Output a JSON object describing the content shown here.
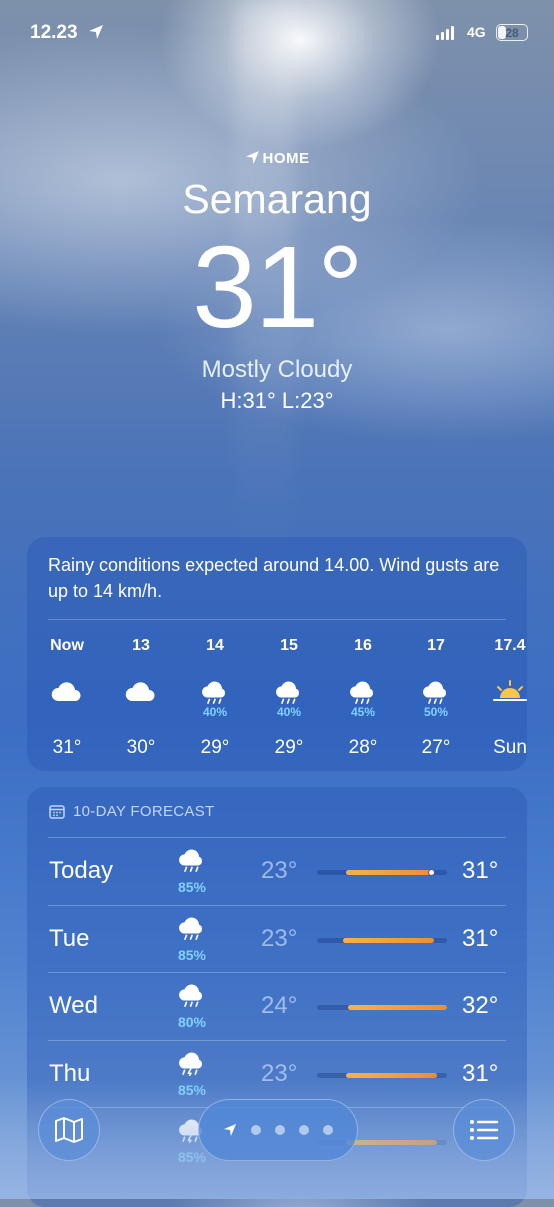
{
  "status_bar": {
    "time": "12.23",
    "network": "4G",
    "battery": "28",
    "battery_level": 0.28
  },
  "header": {
    "home_label": "HOME",
    "city": "Semarang",
    "temperature": "31°",
    "condition": "Mostly Cloudy",
    "high_low": "H:31°  L:23°"
  },
  "hourly": {
    "summary": "Rainy conditions expected around 14.00. Wind gusts are up to 14 km/h.",
    "items": [
      {
        "label": "Now",
        "icon": "cloud-icon",
        "pop": "",
        "temp": "31°"
      },
      {
        "label": "13",
        "icon": "cloud-icon",
        "pop": "",
        "temp": "30°"
      },
      {
        "label": "14",
        "icon": "cloud-rain-icon",
        "pop": "40%",
        "temp": "29°"
      },
      {
        "label": "15",
        "icon": "cloud-rain-icon",
        "pop": "40%",
        "temp": "29°"
      },
      {
        "label": "16",
        "icon": "cloud-rain-icon",
        "pop": "45%",
        "temp": "28°"
      },
      {
        "label": "17",
        "icon": "cloud-rain-icon",
        "pop": "50%",
        "temp": "27°"
      },
      {
        "label": "17.4",
        "icon": "sunset-icon",
        "pop": "",
        "temp": "Sun"
      }
    ]
  },
  "forecast": {
    "title": "10-DAY FORECAST",
    "days": [
      {
        "day": "Today",
        "icon": "cloud-rain-icon",
        "pop": "85%",
        "low": "23°",
        "high": "31°",
        "range_start": 0.22,
        "range_end": 0.88,
        "current": 0.88
      },
      {
        "day": "Tue",
        "icon": "cloud-rain-icon",
        "pop": "85%",
        "low": "23°",
        "high": "31°",
        "range_start": 0.2,
        "range_end": 0.9
      },
      {
        "day": "Wed",
        "icon": "cloud-rain-icon",
        "pop": "80%",
        "low": "24°",
        "high": "32°",
        "range_start": 0.24,
        "range_end": 1.0
      },
      {
        "day": "Thu",
        "icon": "cloud-bolt-rain-icon",
        "pop": "85%",
        "low": "23°",
        "high": "31°",
        "range_start": 0.22,
        "range_end": 0.92
      },
      {
        "day": "",
        "icon": "cloud-bolt-rain-icon",
        "pop": "85%",
        "low": "",
        "high": "",
        "range_start": 0.22,
        "range_end": 0.92
      }
    ]
  },
  "toolbar": {
    "map": "map-icon",
    "list": "list-icon",
    "pages": 4
  }
}
